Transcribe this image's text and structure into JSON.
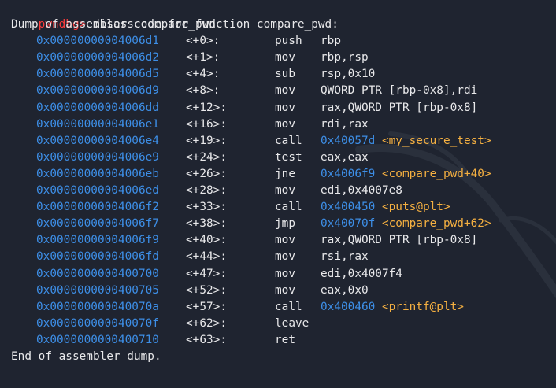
{
  "colors": {
    "background": "#1f2430",
    "text": "#e8e8ea",
    "prompt": "#ff3b3b",
    "address": "#3d8ee6",
    "symbol": "#f5b041"
  },
  "prompt": {
    "label": "pwndbg>",
    "command": "disass compare_pwd"
  },
  "header": "Dump of assembler code for function compare_pwd:",
  "instructions": [
    {
      "addr": "0x00000000004006d1",
      "off": "<+0>:",
      "mnem": "push",
      "ops": "rbp",
      "taddr": "",
      "sym": ""
    },
    {
      "addr": "0x00000000004006d2",
      "off": "<+1>:",
      "mnem": "mov",
      "ops": "rbp,rsp",
      "taddr": "",
      "sym": ""
    },
    {
      "addr": "0x00000000004006d5",
      "off": "<+4>:",
      "mnem": "sub",
      "ops": "rsp,0x10",
      "taddr": "",
      "sym": ""
    },
    {
      "addr": "0x00000000004006d9",
      "off": "<+8>:",
      "mnem": "mov",
      "ops": "QWORD PTR [rbp-0x8],rdi",
      "taddr": "",
      "sym": ""
    },
    {
      "addr": "0x00000000004006dd",
      "off": "<+12>:",
      "mnem": "mov",
      "ops": "rax,QWORD PTR [rbp-0x8]",
      "taddr": "",
      "sym": ""
    },
    {
      "addr": "0x00000000004006e1",
      "off": "<+16>:",
      "mnem": "mov",
      "ops": "rdi,rax",
      "taddr": "",
      "sym": ""
    },
    {
      "addr": "0x00000000004006e4",
      "off": "<+19>:",
      "mnem": "call",
      "ops": "",
      "taddr": "0x40057d",
      "sym": "<my_secure_test>"
    },
    {
      "addr": "0x00000000004006e9",
      "off": "<+24>:",
      "mnem": "test",
      "ops": "eax,eax",
      "taddr": "",
      "sym": ""
    },
    {
      "addr": "0x00000000004006eb",
      "off": "<+26>:",
      "mnem": "jne",
      "ops": "",
      "taddr": "0x4006f9",
      "sym": "<compare_pwd+40>"
    },
    {
      "addr": "0x00000000004006ed",
      "off": "<+28>:",
      "mnem": "mov",
      "ops": "edi,0x4007e8",
      "taddr": "",
      "sym": ""
    },
    {
      "addr": "0x00000000004006f2",
      "off": "<+33>:",
      "mnem": "call",
      "ops": "",
      "taddr": "0x400450",
      "sym": "<puts@plt>"
    },
    {
      "addr": "0x00000000004006f7",
      "off": "<+38>:",
      "mnem": "jmp",
      "ops": "",
      "taddr": "0x40070f",
      "sym": "<compare_pwd+62>"
    },
    {
      "addr": "0x00000000004006f9",
      "off": "<+40>:",
      "mnem": "mov",
      "ops": "rax,QWORD PTR [rbp-0x8]",
      "taddr": "",
      "sym": ""
    },
    {
      "addr": "0x00000000004006fd",
      "off": "<+44>:",
      "mnem": "mov",
      "ops": "rsi,rax",
      "taddr": "",
      "sym": ""
    },
    {
      "addr": "0x0000000000400700",
      "off": "<+47>:",
      "mnem": "mov",
      "ops": "edi,0x4007f4",
      "taddr": "",
      "sym": ""
    },
    {
      "addr": "0x0000000000400705",
      "off": "<+52>:",
      "mnem": "mov",
      "ops": "eax,0x0",
      "taddr": "",
      "sym": ""
    },
    {
      "addr": "0x000000000040070a",
      "off": "<+57>:",
      "mnem": "call",
      "ops": "",
      "taddr": "0x400460",
      "sym": "<printf@plt>"
    },
    {
      "addr": "0x000000000040070f",
      "off": "<+62>:",
      "mnem": "leave",
      "ops": "",
      "taddr": "",
      "sym": ""
    },
    {
      "addr": "0x0000000000400710",
      "off": "<+63>:",
      "mnem": "ret",
      "ops": "",
      "taddr": "",
      "sym": ""
    }
  ],
  "footer": "End of assembler dump."
}
